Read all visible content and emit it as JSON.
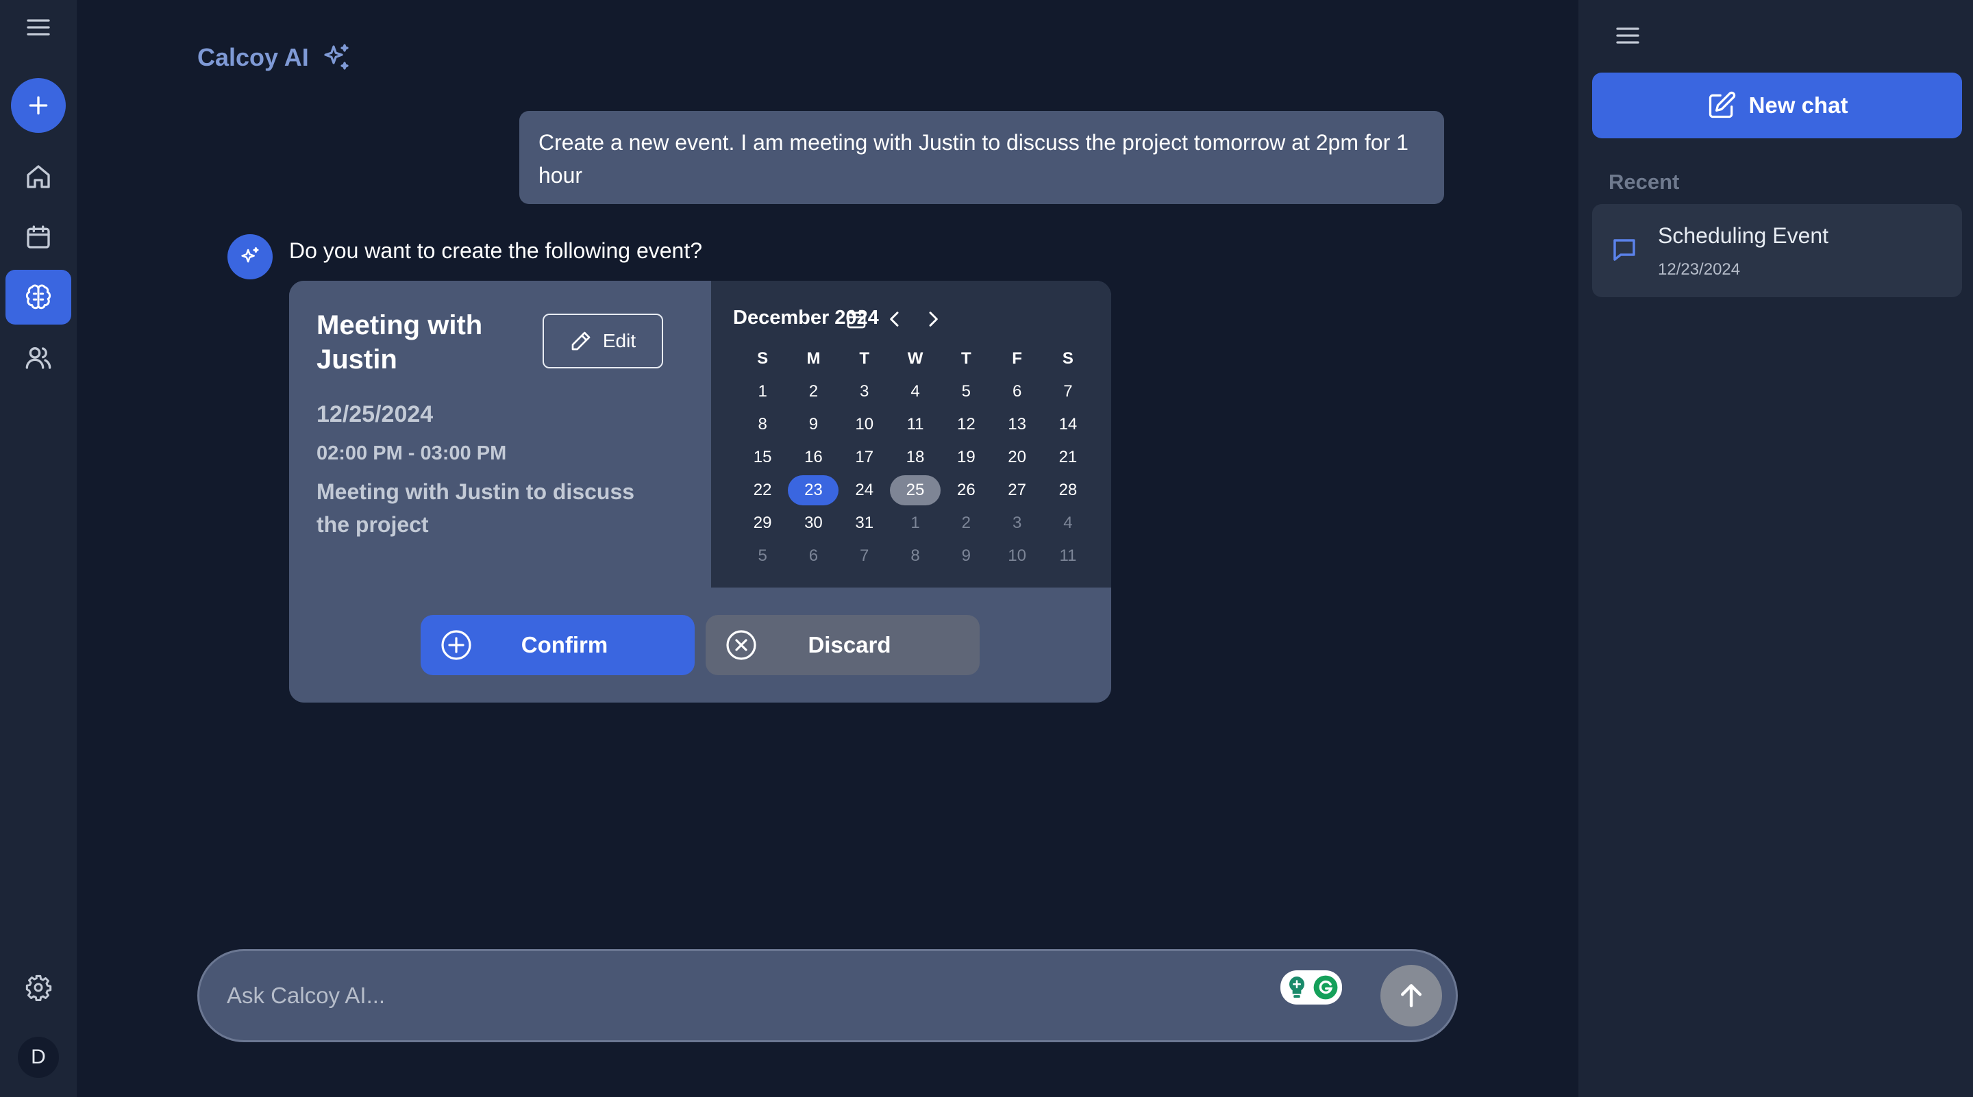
{
  "brand": {
    "name": "Calcoy AI",
    "icon": "sparkles-icon"
  },
  "rail": {
    "items": [
      {
        "name": "menu",
        "icon": "menu-icon"
      },
      {
        "name": "new",
        "icon": "plus-icon"
      },
      {
        "name": "home",
        "icon": "home-icon"
      },
      {
        "name": "calendar",
        "icon": "calendar-icon"
      },
      {
        "name": "ai",
        "icon": "brain-icon",
        "active": true
      },
      {
        "name": "contacts",
        "icon": "users-icon"
      },
      {
        "name": "settings",
        "icon": "gear-icon"
      }
    ],
    "avatar_initial": "D"
  },
  "chat": {
    "user_message": "Create a new event. I am meeting with Justin to discuss the project tomorrow at 2pm for 1 hour",
    "ai_message": "Do you want to create the following event?"
  },
  "event": {
    "title": "Meeting with Justin",
    "edit_label": "Edit",
    "date": "12/25/2024",
    "time": "02:00 PM - 03:00 PM",
    "description": "Meeting with Justin to discuss the project",
    "confirm_label": "Confirm",
    "discard_label": "Discard"
  },
  "calendar": {
    "month_label": "December 2024",
    "weekdays": [
      "S",
      "M",
      "T",
      "W",
      "T",
      "F",
      "S"
    ],
    "days": [
      {
        "d": "1"
      },
      {
        "d": "2"
      },
      {
        "d": "3"
      },
      {
        "d": "4"
      },
      {
        "d": "5"
      },
      {
        "d": "6"
      },
      {
        "d": "7"
      },
      {
        "d": "8"
      },
      {
        "d": "9"
      },
      {
        "d": "10"
      },
      {
        "d": "11"
      },
      {
        "d": "12"
      },
      {
        "d": "13"
      },
      {
        "d": "14"
      },
      {
        "d": "15"
      },
      {
        "d": "16"
      },
      {
        "d": "17"
      },
      {
        "d": "18"
      },
      {
        "d": "19"
      },
      {
        "d": "20"
      },
      {
        "d": "21"
      },
      {
        "d": "22"
      },
      {
        "d": "23",
        "state": "today"
      },
      {
        "d": "24"
      },
      {
        "d": "25",
        "state": "selected"
      },
      {
        "d": "26"
      },
      {
        "d": "27"
      },
      {
        "d": "28"
      },
      {
        "d": "29"
      },
      {
        "d": "30"
      },
      {
        "d": "31"
      },
      {
        "d": "1",
        "state": "other"
      },
      {
        "d": "2",
        "state": "other"
      },
      {
        "d": "3",
        "state": "other"
      },
      {
        "d": "4",
        "state": "other"
      },
      {
        "d": "5",
        "state": "other"
      },
      {
        "d": "6",
        "state": "other"
      },
      {
        "d": "7",
        "state": "other"
      },
      {
        "d": "8",
        "state": "other"
      },
      {
        "d": "9",
        "state": "other"
      },
      {
        "d": "10",
        "state": "other"
      },
      {
        "d": "11",
        "state": "other"
      }
    ]
  },
  "composer": {
    "placeholder": "Ask Calcoy AI..."
  },
  "sidebar": {
    "new_chat_label": "New chat",
    "recent_label": "Recent",
    "recent_items": [
      {
        "title": "Scheduling Event",
        "date": "12/23/2024"
      }
    ]
  },
  "colors": {
    "background": "#121a2c",
    "panel": "#1c2537",
    "accent": "#3a66e0",
    "card": "#4a5774",
    "brand_text": "#7f9ad6"
  }
}
